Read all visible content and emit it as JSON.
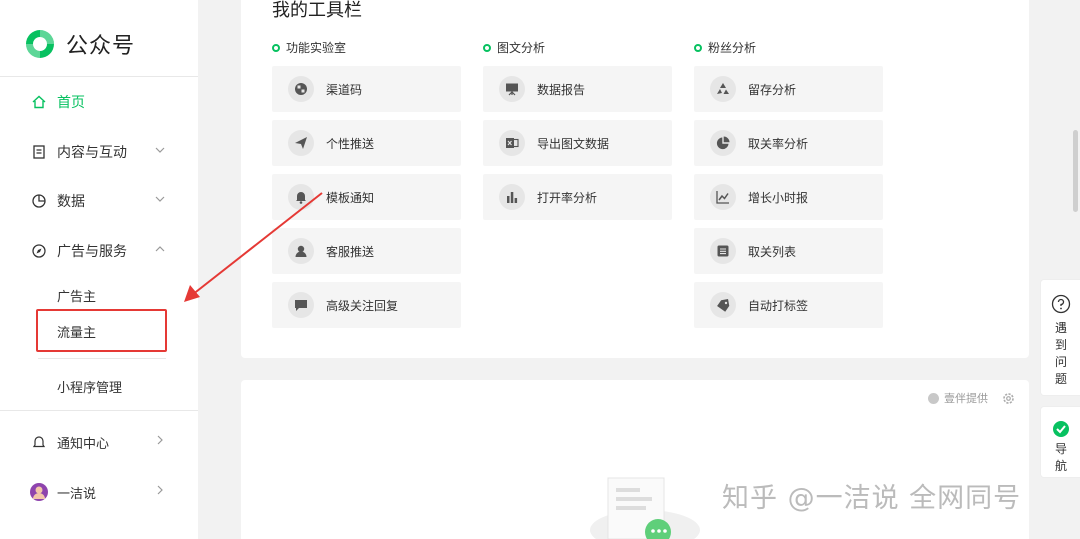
{
  "brand": {
    "name": "公众号"
  },
  "sidebar": {
    "home": "首页",
    "content": "内容与互动",
    "data": "数据",
    "ads": "广告与服务",
    "advertiser": "广告主",
    "publisher": "流量主",
    "miniprogram": "小程序管理",
    "notice": "通知中心",
    "user": "一洁说"
  },
  "toolbar": {
    "title": "我的工具栏",
    "columns": [
      {
        "title": "功能实验室",
        "items": [
          "渠道码",
          "个性推送",
          "模板通知",
          "客服推送",
          "高级关注回复"
        ]
      },
      {
        "title": "图文分析",
        "items": [
          "数据报告",
          "导出图文数据",
          "打开率分析"
        ]
      },
      {
        "title": "粉丝分析",
        "items": [
          "留存分析",
          "取关率分析",
          "增长小时报",
          "取关列表",
          "自动打标签"
        ]
      }
    ]
  },
  "provider": "壹伴提供",
  "float": {
    "help": "遇到问题",
    "nav": "导航"
  },
  "watermark": "知乎 @一洁说 全网同号",
  "colors": {
    "accent": "#07c160",
    "highlight": "#e53935"
  }
}
